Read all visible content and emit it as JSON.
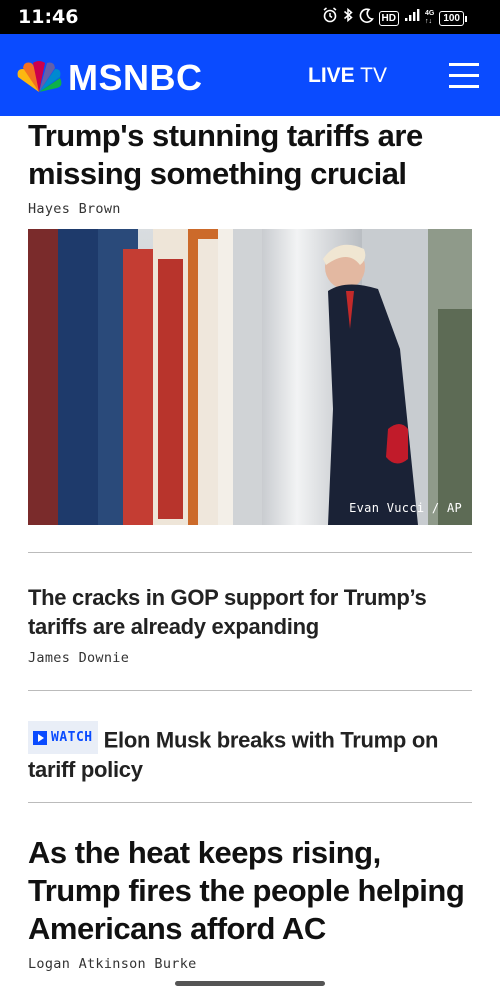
{
  "status_bar": {
    "time": "11:46",
    "icons": [
      "alarm-icon",
      "bluetooth-icon",
      "moon-icon",
      "hd-icon",
      "signal-icon",
      "network-icon",
      "battery-icon"
    ],
    "hd": "HD",
    "net_top": "4G",
    "net_bottom": "↑↓",
    "battery": "100"
  },
  "header": {
    "brand": "MSNBC",
    "live_primary": "LIVE",
    "live_secondary": "TV",
    "background": "#0a4bff",
    "menu_icon": "hamburger-menu-icon"
  },
  "articles": [
    {
      "headline": "Trump's stunning tariffs are missing something crucial",
      "byline": "Hayes Brown",
      "image_credit": "Evan Vucci / AP"
    },
    {
      "headline": "The cracks in GOP support for Trump’s tariffs are already expanding",
      "byline": "James Downie"
    },
    {
      "watch_label": "WATCH",
      "headline": "Elon Musk breaks with Trump on tariff policy"
    },
    {
      "headline": "As the heat keeps rising, Trump fires the people helping Americans afford AC",
      "byline": "Logan Atkinson Burke"
    }
  ]
}
